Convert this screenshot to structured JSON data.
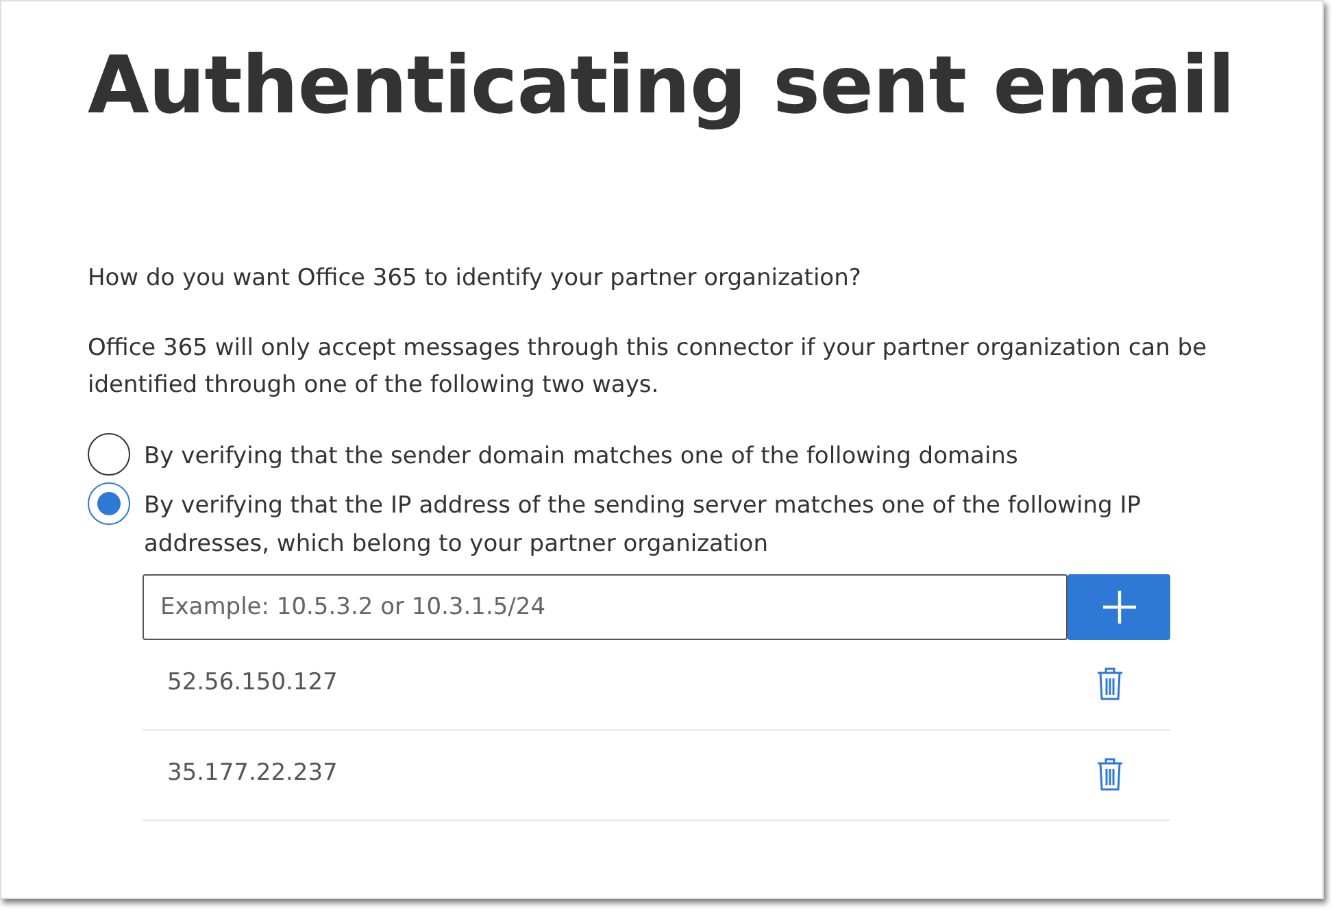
{
  "title": "Authenticating sent email",
  "question": "How do you want Office 365 to identify your partner organization?",
  "description": "Office 365 will only accept messages through this connector if your partner organization can be identified through one of the following two ways.",
  "options": [
    {
      "label": "By verifying that the sender domain matches one of the following domains",
      "selected": false
    },
    {
      "label": "By verifying that the IP address of the sending server matches one of the following IP addresses, which belong to your partner organization",
      "selected": true
    }
  ],
  "ip_input": {
    "placeholder": "Example: 10.5.3.2 or 10.3.1.5/24"
  },
  "ip_addresses": [
    "52.56.150.127",
    "35.177.22.237"
  ]
}
